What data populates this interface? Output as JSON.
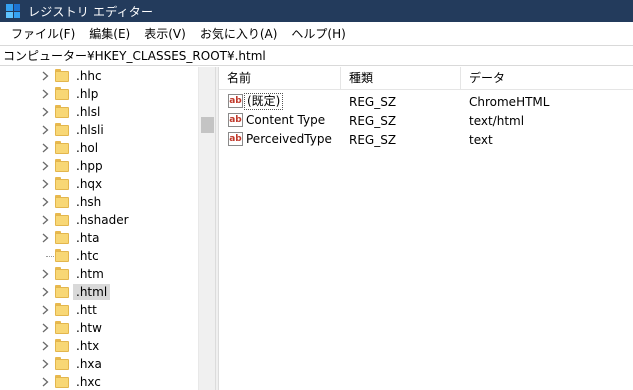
{
  "window": {
    "title": "レジストリ エディター",
    "icon": "registry-editor-icon"
  },
  "menu": [
    "ファイル(F)",
    "編集(E)",
    "表示(V)",
    "お気に入り(A)",
    "ヘルプ(H)"
  ],
  "address": "コンピューター¥HKEY_CLASSES_ROOT¥.html",
  "tree": [
    {
      "label": ".hhc",
      "expandable": true
    },
    {
      "label": ".hlp",
      "expandable": true
    },
    {
      "label": ".hlsl",
      "expandable": true
    },
    {
      "label": ".hlsli",
      "expandable": true
    },
    {
      "label": ".hol",
      "expandable": true
    },
    {
      "label": ".hpp",
      "expandable": true
    },
    {
      "label": ".hqx",
      "expandable": true
    },
    {
      "label": ".hsh",
      "expandable": true
    },
    {
      "label": ".hshader",
      "expandable": true
    },
    {
      "label": ".hta",
      "expandable": true
    },
    {
      "label": ".htc",
      "expandable": false
    },
    {
      "label": ".htm",
      "expandable": true
    },
    {
      "label": ".html",
      "expandable": true,
      "selected": true
    },
    {
      "label": ".htt",
      "expandable": true
    },
    {
      "label": ".htw",
      "expandable": true
    },
    {
      "label": ".htx",
      "expandable": true
    },
    {
      "label": ".hxa",
      "expandable": true
    },
    {
      "label": ".hxc",
      "expandable": true
    }
  ],
  "columns": {
    "name": "名前",
    "type": "種類",
    "data": "データ"
  },
  "values": [
    {
      "name": "(既定)",
      "type": "REG_SZ",
      "data": "ChromeHTML",
      "icon": "string-value-icon"
    },
    {
      "name": "Content Type",
      "type": "REG_SZ",
      "data": "text/html",
      "icon": "string-value-icon"
    },
    {
      "name": "PerceivedType",
      "type": "REG_SZ",
      "data": "text",
      "icon": "string-value-icon"
    }
  ],
  "colors": {
    "titlebar": "#233b5c",
    "folder": "#f8d775",
    "selection": "#d9d9d9"
  }
}
